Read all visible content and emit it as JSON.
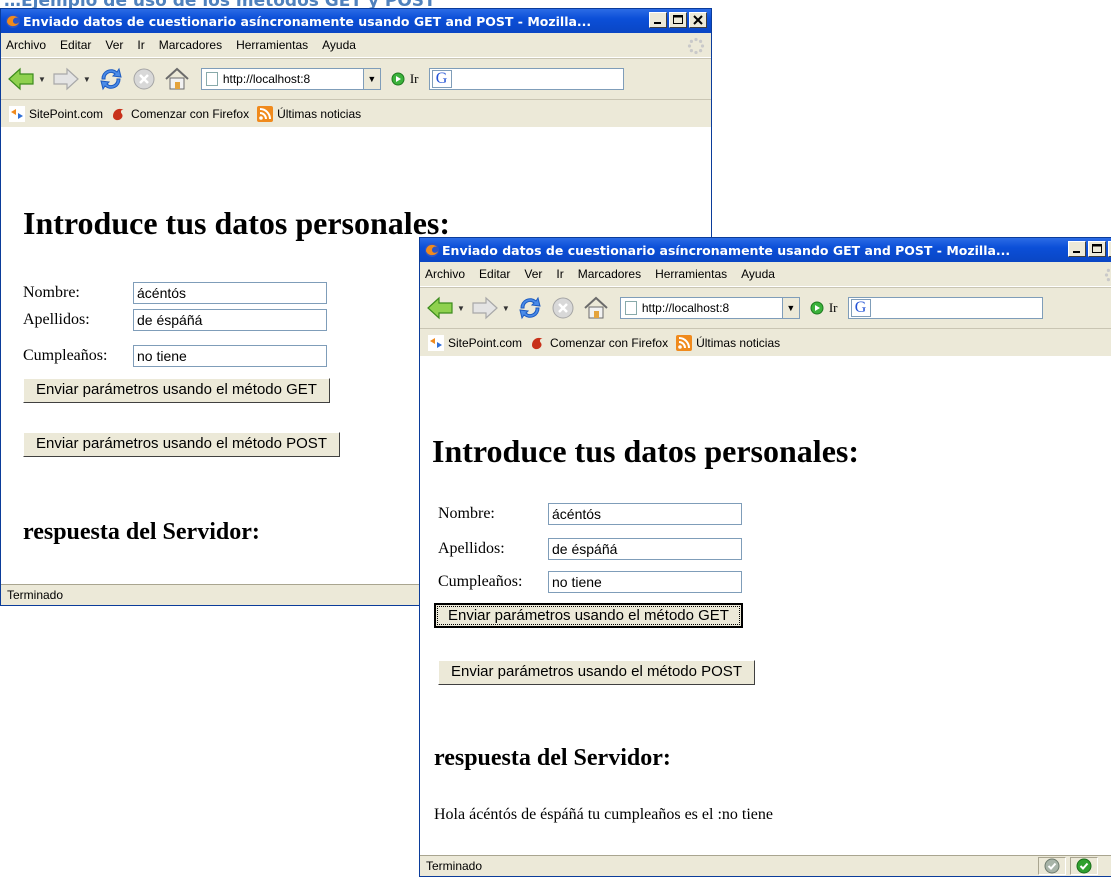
{
  "caption": "…Ejemplo de uso de los métodos GET y POST",
  "window_title": "Enviado datos de cuestionario asíncronamente usando GET and POST - Mozilla...",
  "menu": [
    "Archivo",
    "Editar",
    "Ver",
    "Ir",
    "Marcadores",
    "Herramientas",
    "Ayuda"
  ],
  "url": "http://localhost:8",
  "go_label": "Ir",
  "search_logo": "G",
  "bookmarks": [
    "SitePoint.com",
    "Comenzar con Firefox",
    "Últimas noticias"
  ],
  "page": {
    "heading": "Introduce tus datos personales:",
    "fields": [
      {
        "label": "Nombre:",
        "value": "ácéntós"
      },
      {
        "label": "Apellidos:",
        "value": "de éspáñá"
      },
      {
        "label": "Cumpleaños:",
        "value": "no tiene"
      }
    ],
    "get_button": "Enviar parámetros usando el método GET",
    "post_button": "Enviar parámetros usando el método POST",
    "response_heading": "respuesta del Servidor:",
    "response_text": "Hola ácéntós de éspáñá tu cumpleaños es el :no tiene"
  },
  "status": "Terminado",
  "colors": {
    "titlebar": "#0a4fd6",
    "chrome": "#ece9d8",
    "caption": "#4f81bd"
  }
}
